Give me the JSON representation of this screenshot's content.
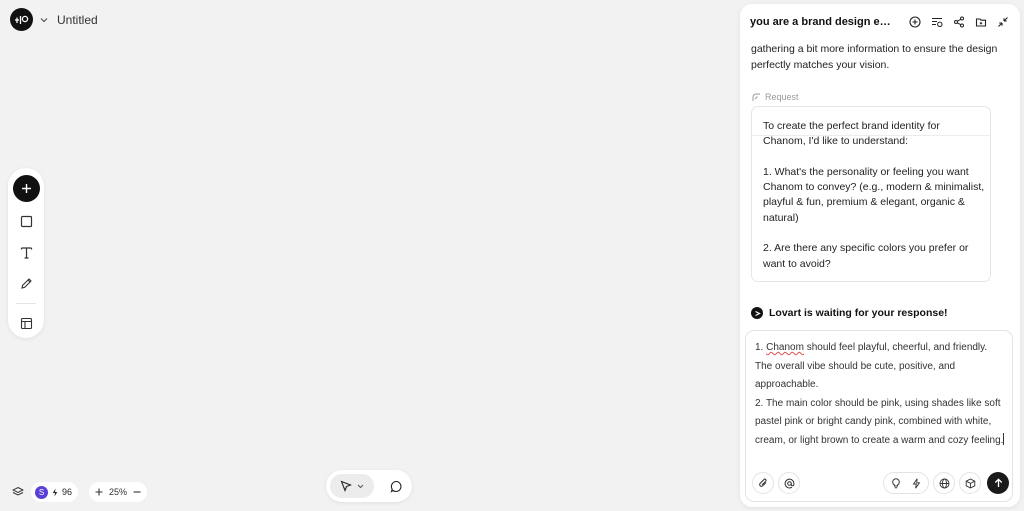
{
  "header": {
    "doc_title": "Untitled",
    "logo_icon": "lovart-logo-icon"
  },
  "toolbar": {
    "tools": [
      "add-icon",
      "rectangle-icon",
      "text-icon",
      "pen-icon",
      "layout-icon"
    ]
  },
  "bottom_left": {
    "credits": "96",
    "avatar_letter": "S",
    "zoom": "25%"
  },
  "chat": {
    "title": "you are a brand design ex...",
    "intro": "gathering a bit more information to ensure the design perfectly matches your vision.",
    "request_label": "Request",
    "request_text": "To create the perfect brand identity for Chanom, I'd like to understand:\n\n1. What's the personality or feeling you want Chanom to convey? (e.g., modern & minimalist, playful & fun, premium & elegant, organic & natural)\n\n2. Are there any specific colors you prefer or want to avoid?",
    "status": "Lovart is waiting for your response!",
    "input": {
      "word_flagged": "Chanom",
      "line1_prefix": "1. ",
      "line1_rest": " should feel playful, cheerful, and friendly. The overall vibe should be cute, positive, and approachable.\n2. The main color should be pink, using shades like soft pastel pink or bright candy pink, combined with white, cream, or light brown to create a warm and cozy feeling."
    }
  },
  "colors": {
    "accent": "#111111",
    "avatar": "#5b3fd6",
    "spell_underline": "#e05050"
  }
}
